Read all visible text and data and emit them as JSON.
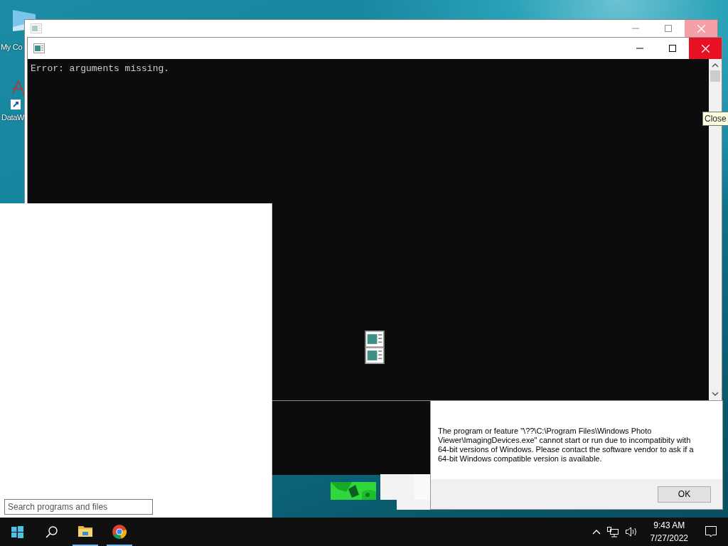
{
  "desktop": {
    "icons": [
      {
        "label": "My Co"
      },
      {
        "label": "DataW"
      }
    ]
  },
  "console_window": {
    "output": "Error: arguments missing.",
    "tooltip": "Close"
  },
  "start_panel": {
    "search": {
      "placeholder": "Search programs and files"
    }
  },
  "dialog": {
    "message": "The program or feature \"\\??\\C:\\Program Files\\Windows Photo Viewer\\ImagingDevices.exe\" cannot start or run due to incompatibity with 64-bit versions of Windows. Please contact the software vendor to ask if a 64-bit Windows compatible version is available.",
    "button": "OK"
  },
  "taskbar": {
    "apps": [
      {
        "kind": "folder",
        "running": true
      },
      {
        "kind": "browser",
        "running": true
      }
    ],
    "time": "9:43 AM",
    "date": "7/27/2022"
  }
}
